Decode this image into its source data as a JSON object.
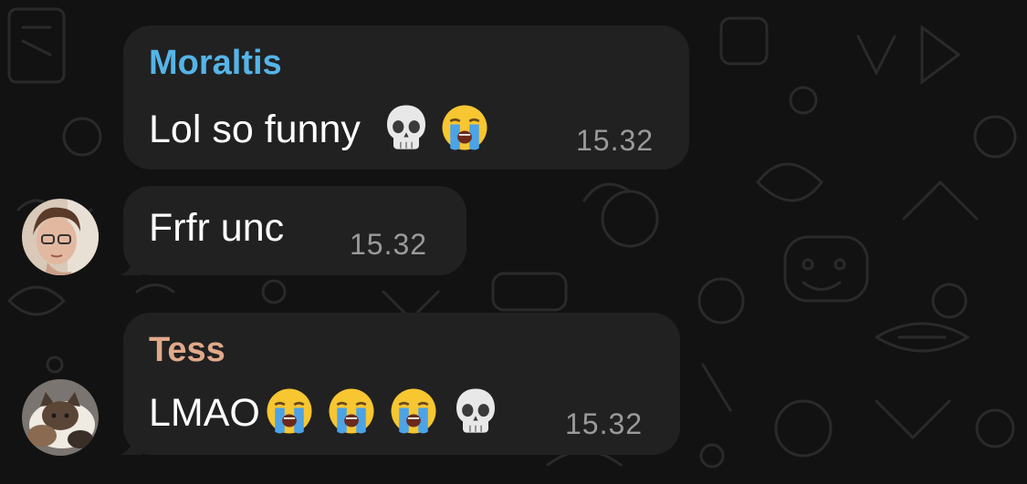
{
  "theme": {
    "background": "#121212",
    "bubble": "#212121",
    "text": "#ffffff",
    "time_color": "#9a9a9a"
  },
  "messages": [
    {
      "sender": "Moraltis",
      "sender_color": "#55b4e8",
      "text": "Lol so funny",
      "emojis": [
        "skull-emoji",
        "loudly-crying-face-emoji"
      ],
      "time": "15.32"
    },
    {
      "text": "Frfr unc",
      "time": "15.32",
      "avatar": "avatar-woman-with-glasses"
    },
    {
      "sender": "Tess",
      "sender_color": "#e0a98a",
      "text": "LMAO",
      "emojis": [
        "loudly-crying-face-emoji",
        "loudly-crying-face-emoji",
        "loudly-crying-face-emoji",
        "skull-emoji"
      ],
      "time": "15.32",
      "avatar": "avatar-cat-photo"
    }
  ]
}
